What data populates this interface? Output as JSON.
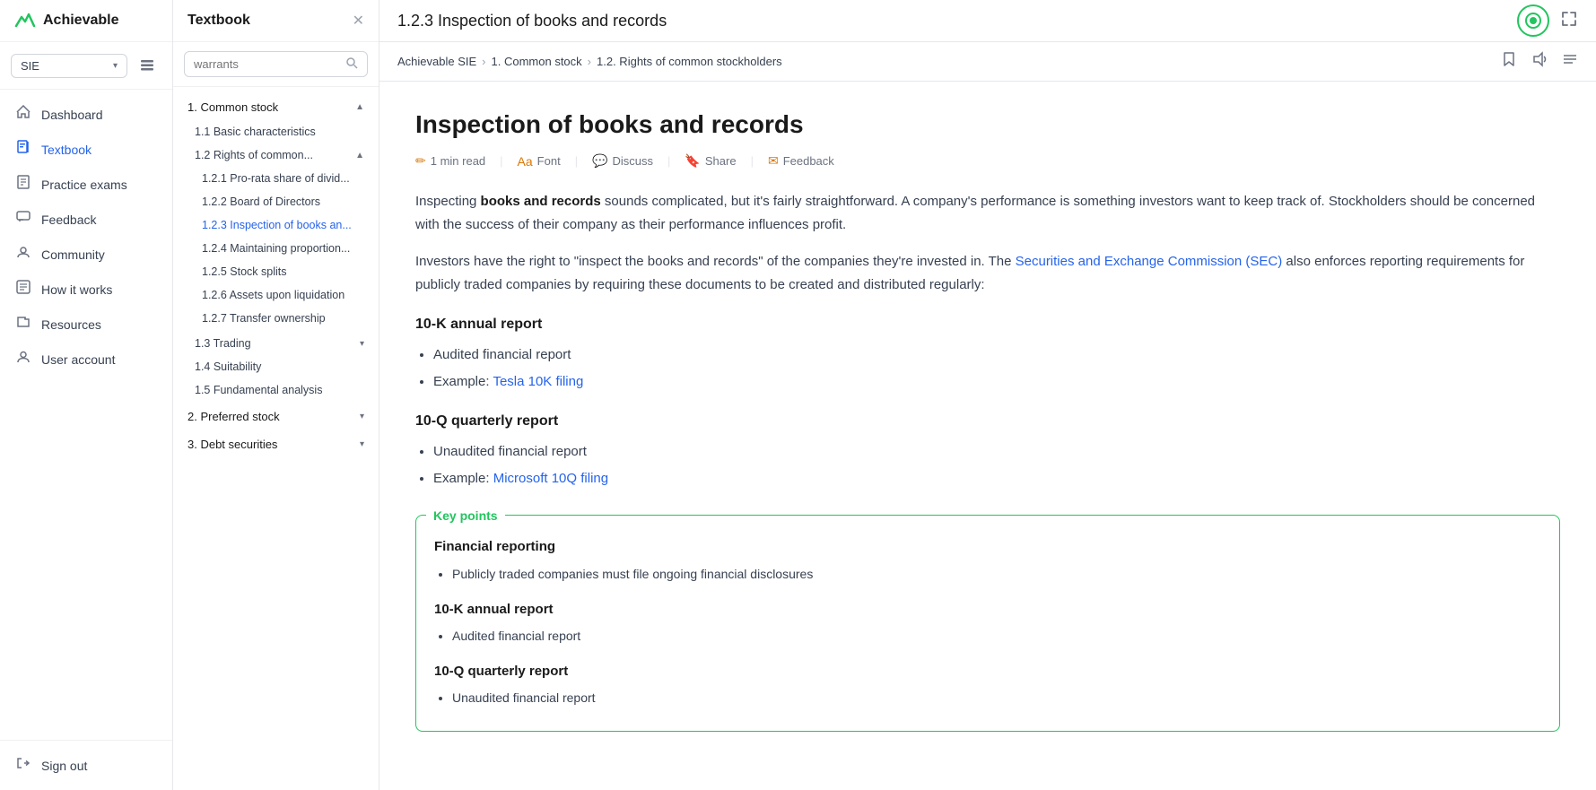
{
  "app": {
    "name": "Achievable",
    "logo_symbol": "⛰"
  },
  "subject_selector": {
    "current": "SIE",
    "placeholder": "SIE"
  },
  "left_nav": {
    "items": [
      {
        "id": "dashboard",
        "label": "Dashboard",
        "icon": "📈",
        "active": false
      },
      {
        "id": "textbook",
        "label": "Textbook",
        "icon": "📖",
        "active": true
      },
      {
        "id": "practice-exams",
        "label": "Practice exams",
        "icon": "📝",
        "active": false
      },
      {
        "id": "feedback",
        "label": "Feedback",
        "icon": "✉",
        "active": false
      },
      {
        "id": "community",
        "label": "Community",
        "icon": "💬",
        "active": false
      },
      {
        "id": "how-it-works",
        "label": "How it works",
        "icon": "📋",
        "active": false
      },
      {
        "id": "resources",
        "label": "Resources",
        "icon": "📁",
        "active": false
      },
      {
        "id": "user-account",
        "label": "User account",
        "icon": "👤",
        "active": false
      }
    ],
    "bottom_items": [
      {
        "id": "sign-out",
        "label": "Sign out",
        "icon": "🚪",
        "active": false
      }
    ]
  },
  "textbook_panel": {
    "title": "Textbook",
    "search_placeholder": "warrants",
    "toc": [
      {
        "id": "section-1",
        "label": "1. Common stock",
        "expanded": true,
        "children": [
          {
            "id": "1.1",
            "label": "1.1 Basic characteristics",
            "indent": 1,
            "active": false
          },
          {
            "id": "1.2",
            "label": "1.2 Rights of common...",
            "indent": 1,
            "expanded": true,
            "children": [
              {
                "id": "1.2.1",
                "label": "1.2.1 Pro-rata share of divid...",
                "indent": 2,
                "active": false
              },
              {
                "id": "1.2.2",
                "label": "1.2.2 Board of Directors",
                "indent": 2,
                "active": false
              },
              {
                "id": "1.2.3",
                "label": "1.2.3 Inspection of books an...",
                "indent": 2,
                "active": true
              },
              {
                "id": "1.2.4",
                "label": "1.2.4 Maintaining proportion...",
                "indent": 2,
                "active": false
              },
              {
                "id": "1.2.5",
                "label": "1.2.5 Stock splits",
                "indent": 2,
                "active": false
              },
              {
                "id": "1.2.6",
                "label": "1.2.6 Assets upon liquidation",
                "indent": 2,
                "active": false
              },
              {
                "id": "1.2.7",
                "label": "1.2.7 Transfer ownership",
                "indent": 2,
                "active": false
              }
            ]
          },
          {
            "id": "1.3",
            "label": "1.3 Trading",
            "indent": 1,
            "active": false,
            "hasArrow": true
          },
          {
            "id": "1.4",
            "label": "1.4 Suitability",
            "indent": 1,
            "active": false
          },
          {
            "id": "1.5",
            "label": "1.5 Fundamental analysis",
            "indent": 1,
            "active": false
          }
        ]
      },
      {
        "id": "section-2",
        "label": "2. Preferred stock",
        "expanded": false
      },
      {
        "id": "section-3",
        "label": "3. Debt securities",
        "expanded": false
      }
    ]
  },
  "content_header": {
    "title": "1.2.3 Inspection of books and records",
    "circle_btn_icon": "◉",
    "expand_icon": "⛶"
  },
  "breadcrumb": {
    "items": [
      {
        "id": "achievable-sie",
        "label": "Achievable SIE"
      },
      {
        "id": "common-stock",
        "label": "1. Common stock"
      },
      {
        "id": "rights",
        "label": "1.2. Rights of common stockholders"
      }
    ],
    "actions": [
      {
        "id": "bookmark",
        "icon": "🔖"
      },
      {
        "id": "audio",
        "icon": "🔊"
      },
      {
        "id": "toc",
        "icon": "☰"
      }
    ]
  },
  "article": {
    "title": "Inspection of books and records",
    "meta": {
      "read_time": "1 min read",
      "font_label": "Font",
      "discuss_label": "Discuss",
      "share_label": "Share",
      "feedback_label": "Feedback"
    },
    "intro_paragraph": "Inspecting books and records sounds complicated, but it's fairly straightforward. A company's performance is something investors want to keep track of. Stockholders should be concerned with the success of their company as their performance influences profit.",
    "second_paragraph_start": "Investors have the right to \"inspect the books and records\" of the companies they're invested in. The ",
    "sec_link_text": "Securities and Exchange Commission (SEC)",
    "second_paragraph_end": " also enforces reporting requirements for publicly traded companies by requiring these documents to be created and distributed regularly:",
    "report_10k": {
      "heading": "10-K annual report",
      "bullets": [
        "Audited financial report",
        {
          "text": "Example: ",
          "link_text": "Tesla 10K filing",
          "link": "#"
        }
      ]
    },
    "report_10q": {
      "heading": "10-Q quarterly report",
      "bullets": [
        "Unaudited financial report",
        {
          "text": "Example: ",
          "link_text": "Microsoft 10Q filing",
          "link": "#"
        }
      ]
    },
    "key_points": {
      "label": "Key points",
      "sections": [
        {
          "heading": "Financial reporting",
          "bullets": [
            "Publicly traded companies must file ongoing financial disclosures"
          ]
        },
        {
          "heading": "10-K annual report",
          "bullets": [
            "Audited financial report"
          ]
        },
        {
          "heading": "10-Q quarterly report",
          "bullets": [
            "Unaudited financial report"
          ]
        }
      ]
    }
  }
}
